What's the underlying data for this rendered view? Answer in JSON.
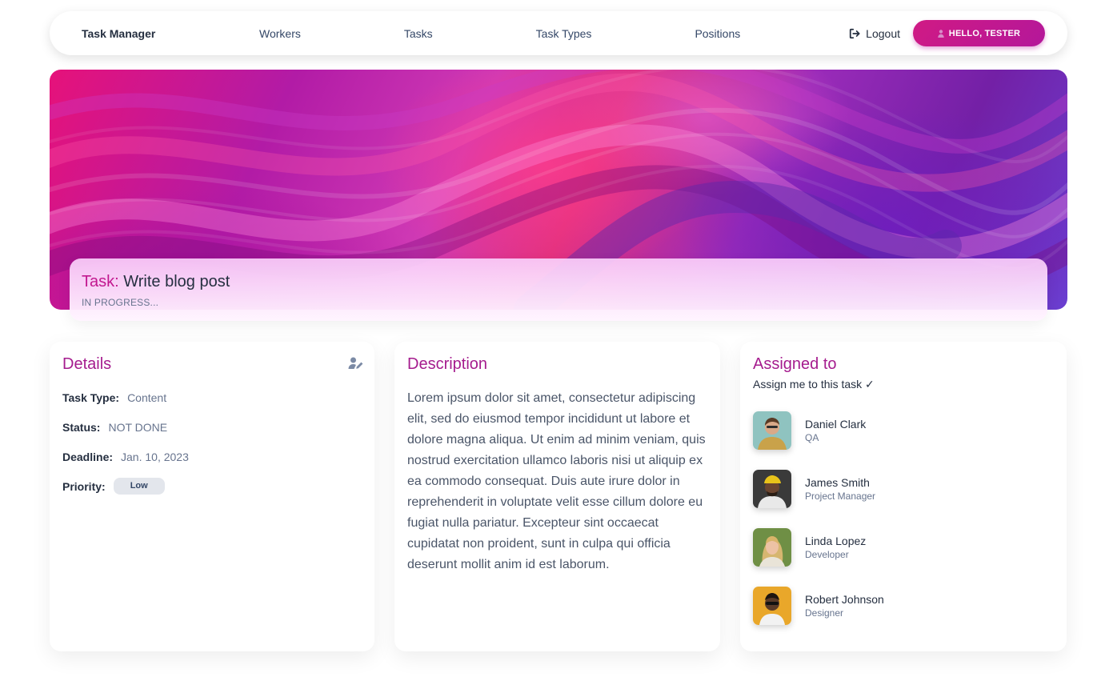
{
  "nav": {
    "brand": "Task Manager",
    "links": [
      "Workers",
      "Tasks",
      "Task Types",
      "Positions"
    ],
    "logout_label": "Logout",
    "user_button_label": "HELLO, TESTER"
  },
  "task": {
    "title_label": "Task:",
    "title": "Write blog post",
    "status": "IN PROGRESS..."
  },
  "details": {
    "heading": "Details",
    "rows": [
      {
        "key": "Task Type:",
        "value": "Content"
      },
      {
        "key": "Status:",
        "value": "NOT DONE"
      },
      {
        "key": "Deadline:",
        "value": "Jan. 10, 2023"
      },
      {
        "key": "Priority:",
        "value": "Low"
      }
    ]
  },
  "description": {
    "heading": "Description",
    "text": "Lorem ipsum dolor sit amet, consectetur adipiscing elit, sed do eiusmod tempor incididunt ut labore et dolore magna aliqua. Ut enim ad minim veniam, quis nostrud exercitation ullamco laboris nisi ut aliquip ex ea commodo consequat. Duis aute irure dolor in reprehenderit in voluptate velit esse cillum dolore eu fugiat nulla pariatur. Excepteur sint occaecat cupidatat non proident, sunt in culpa qui officia deserunt mollit anim id est laborum."
  },
  "assigned": {
    "heading": "Assigned to",
    "assign_link": "Assign me to this task ✓",
    "people": [
      {
        "name": "Daniel Clark",
        "role": "QA"
      },
      {
        "name": "James Smith",
        "role": "Project Manager"
      },
      {
        "name": "Linda Lopez",
        "role": "Developer"
      },
      {
        "name": "Robert Johnson",
        "role": "Designer"
      }
    ]
  },
  "colors": {
    "accent": "#c2188f",
    "heading": "#a51c8e",
    "badge_bg": "#e3e6ec"
  }
}
